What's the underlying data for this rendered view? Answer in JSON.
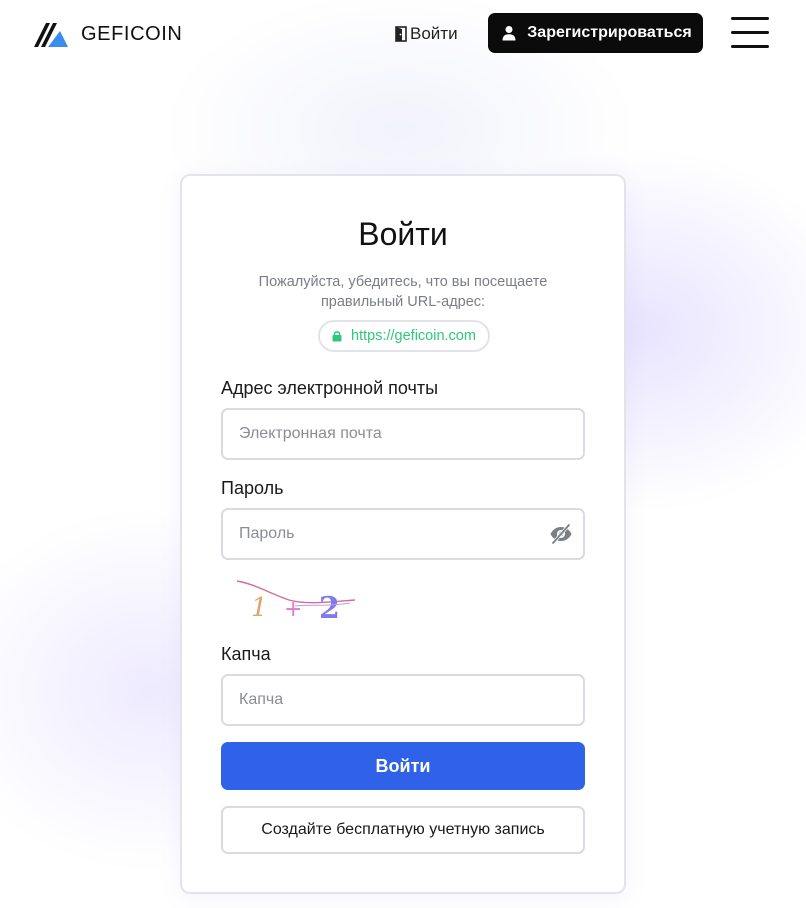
{
  "header": {
    "brand": "GEFICOIN",
    "login_label": "Войти",
    "register_label": "Зарегистрироваться"
  },
  "form": {
    "title": "Войти",
    "notice": "Пожалуйста, убедитесь, что вы посещаете правильный URL-адрес:",
    "url": "https://geficoin.com",
    "email": {
      "label": "Адрес электронной почты",
      "placeholder": "Электронная почта",
      "value": ""
    },
    "password": {
      "label": "Пароль",
      "placeholder": "Пароль",
      "value": ""
    },
    "captcha": {
      "image_text": "1 + 2",
      "label": "Капча",
      "placeholder": "Капча",
      "value": ""
    },
    "submit_label": "Войти",
    "create_account_label": "Создайте бесплатную учетную запись"
  },
  "colors": {
    "primary": "#2f62e9",
    "dark_button": "#0b0b0c",
    "secure_url": "#2fc77b",
    "logo_blue": "#3b8bf0"
  },
  "icons": {
    "logo": "geficoin-logo-icon",
    "login": "door-icon",
    "register": "user-icon",
    "menu": "hamburger-menu-icon",
    "secure": "lock-icon",
    "password_toggle": "eye-off-icon"
  }
}
